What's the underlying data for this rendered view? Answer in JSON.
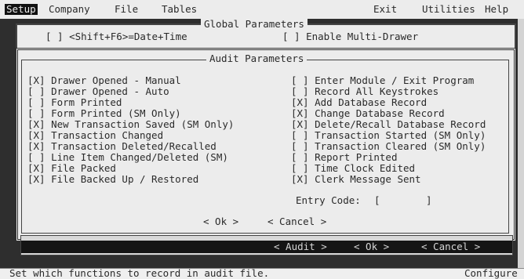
{
  "menubar": {
    "items": [
      "Setup",
      "Company",
      "File",
      "Tables"
    ],
    "right_items": [
      "Exit",
      "Utilities",
      "Help"
    ]
  },
  "global": {
    "title": "Global Parameters",
    "date_time": "[ ] <Shift+F6>=Date+Time",
    "multi_drawer": "[ ] Enable Multi-Drawer"
  },
  "audit": {
    "title": "Audit Parameters",
    "left_items": [
      {
        "box": "[X]",
        "label": "Drawer Opened - Manual"
      },
      {
        "box": "[ ]",
        "label": "Drawer Opened - Auto"
      },
      {
        "box": "[ ]",
        "label": "Form Printed"
      },
      {
        "box": "[ ]",
        "label": "Form Printed (SM Only)"
      },
      {
        "box": "[X]",
        "label": "New Transaction Saved (SM Only)"
      },
      {
        "box": "[X]",
        "label": "Transaction Changed"
      },
      {
        "box": "[X]",
        "label": "Transaction Deleted/Recalled"
      },
      {
        "box": "[ ]",
        "label": "Line Item Changed/Deleted (SM)"
      },
      {
        "box": "[X]",
        "label": "File Packed"
      },
      {
        "box": "[X]",
        "label": "File Backed Up / Restored"
      }
    ],
    "right_items": [
      {
        "box": "[ ]",
        "label": "Enter Module / Exit Program"
      },
      {
        "box": "[ ]",
        "label": "Record All Keystrokes"
      },
      {
        "box": "[X]",
        "label": "Add Database Record"
      },
      {
        "box": "[X]",
        "label": "Change Database Record"
      },
      {
        "box": "[X]",
        "label": "Delete/Recall Database Record"
      },
      {
        "box": "[ ]",
        "label": "Transaction Started (SM Only)"
      },
      {
        "box": "[ ]",
        "label": "Transaction Cleared (SM Only)"
      },
      {
        "box": "[ ]",
        "label": "Report Printed"
      },
      {
        "box": "[ ]",
        "label": "Time Clock Edited"
      },
      {
        "box": "[X]",
        "label": "Clerk Message Sent"
      }
    ],
    "entry_code_label": "Entry Code:",
    "entry_code_open": "[",
    "entry_code_close": "]",
    "ok": "< Ok >",
    "cancel": "< Cancel >"
  },
  "bottom": {
    "audit": "< Audit >",
    "ok": "< Ok >",
    "cancel": "< Cancel >"
  },
  "status": {
    "message": "Set which functions to record in audit file.",
    "mode": "Configure"
  }
}
